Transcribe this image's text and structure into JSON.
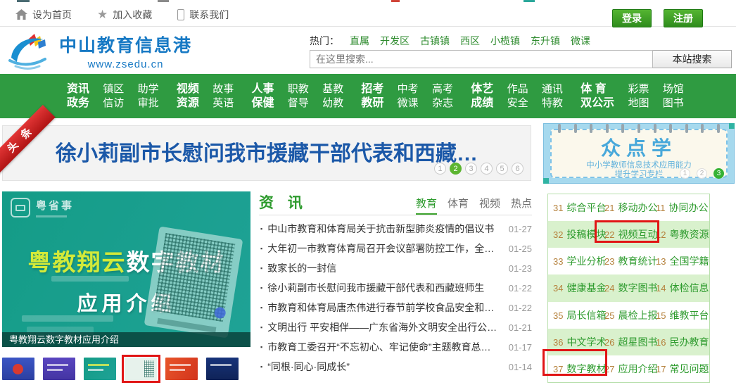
{
  "topbar": {
    "links": [
      {
        "icon": "home-icon",
        "label": "设为首页"
      },
      {
        "icon": "star-icon",
        "label": "加入收藏"
      },
      {
        "icon": "phone-icon",
        "label": "联系我们"
      }
    ],
    "login_label": "登录",
    "register_label": "注册"
  },
  "header": {
    "site_name": "中山教育信息港",
    "site_url": "www.zsedu.cn",
    "hot_label": "热门：",
    "hot_links": [
      "直属",
      "开发区",
      "古镇镇",
      "西区",
      "小榄镇",
      "东升镇",
      "微课"
    ],
    "search": {
      "placeholder": "在这里搜索...",
      "button_label": "本站搜索"
    }
  },
  "nav": {
    "columns": [
      {
        "top": "资讯",
        "bottom": "政务"
      },
      {
        "top": "镇区",
        "bottom": "信访"
      },
      {
        "top": "助学",
        "bottom": "审批"
      },
      {
        "top": "视频",
        "bottom": "资源"
      },
      {
        "top": "故事",
        "bottom": "英语"
      },
      {
        "top": "人事",
        "bottom": "保健"
      },
      {
        "top": "职教",
        "bottom": "督导"
      },
      {
        "top": "基教",
        "bottom": "幼教"
      },
      {
        "top": "招考",
        "bottom": "教研"
      },
      {
        "top": "中考",
        "bottom": "微课"
      },
      {
        "top": "高考",
        "bottom": "杂志"
      },
      {
        "top": "体艺",
        "bottom": "成绩"
      },
      {
        "top": "作品",
        "bottom": "安全"
      },
      {
        "top": "通讯",
        "bottom": "特教"
      },
      {
        "top": "体 育",
        "bottom": "双公示"
      },
      {
        "top": "彩票",
        "bottom": "地图"
      },
      {
        "top": "场馆",
        "bottom": "图书"
      }
    ]
  },
  "headline": {
    "ribbon": "头条",
    "title": "徐小莉副市长慰问我市援藏干部代表和西藏…",
    "pager": [
      "1",
      "2",
      "3",
      "4",
      "5",
      "6"
    ],
    "active_page": "2"
  },
  "promo": {
    "title": "众点学",
    "subtitle_line1": "中小学教师信息技术应用能力",
    "subtitle_line2": "提升学习专栏",
    "pager": [
      "1",
      "2",
      "3"
    ],
    "active_page": "3"
  },
  "carousel": {
    "badge": "粤省事",
    "slide_title_part1": "粤教翔云",
    "slide_title_part2": "数字教材",
    "slide_title_line2": "应用介绍",
    "caption": "粤教翔云数字教材应用介绍",
    "thumbnail_count": 6,
    "active_thumbnail": 4
  },
  "news": {
    "section_title": "资 讯",
    "tabs": [
      {
        "label": "教育",
        "active": true
      },
      {
        "label": "体育",
        "active": false
      },
      {
        "label": "视频",
        "active": false
      },
      {
        "label": "热点",
        "active": false
      }
    ],
    "items": [
      {
        "title": "中山市教育和体育局关于抗击新型肺炎疫情的倡议书",
        "date": "01-27"
      },
      {
        "title": "大年初一市教育体育局召开会议部署防控工作，全力…",
        "date": "01-25"
      },
      {
        "title": "致家长的一封信",
        "date": "01-23"
      },
      {
        "title": "徐小莉副市长慰问我市援藏干部代表和西藏班师生",
        "date": "01-22"
      },
      {
        "title": "市教育和体育局唐杰伟进行春节前学校食品安全和传…",
        "date": "01-22"
      },
      {
        "title": "文明出行 平安相伴——广东省海外文明安全出行公…",
        "date": "01-21"
      },
      {
        "title": "市教育工委召开“不忘初心、牢记使命”主题教育总…",
        "date": "01-17"
      },
      {
        "title": "“同根·同心·同成长”",
        "date": "01-14"
      }
    ]
  },
  "quicklinks": {
    "rows": [
      [
        {
          "num": "31",
          "label": "综合平台"
        },
        {
          "num": "21",
          "label": "移动办公"
        },
        {
          "num": "11",
          "label": "协同办公"
        }
      ],
      [
        {
          "num": "32",
          "label": "投稿模块"
        },
        {
          "num": "22",
          "label": "视频互动"
        },
        {
          "num": "12",
          "label": "粤教资源"
        }
      ],
      [
        {
          "num": "33",
          "label": "学业分析"
        },
        {
          "num": "23",
          "label": "教育统计"
        },
        {
          "num": "13",
          "label": "全国学籍"
        }
      ],
      [
        {
          "num": "34",
          "label": "健康基金"
        },
        {
          "num": "24",
          "label": "数字图书"
        },
        {
          "num": "14",
          "label": "体检信息"
        }
      ],
      [
        {
          "num": "35",
          "label": "局长信箱"
        },
        {
          "num": "25",
          "label": "晨检上报"
        },
        {
          "num": "15",
          "label": "维教平台"
        }
      ],
      [
        {
          "num": "36",
          "label": "中文学术"
        },
        {
          "num": "26",
          "label": "超星图书"
        },
        {
          "num": "16",
          "label": "民办教育"
        }
      ],
      [
        {
          "num": "37",
          "label": "数字教材"
        },
        {
          "num": "27",
          "label": "应用介绍"
        },
        {
          "num": "17",
          "label": "常见问题"
        }
      ]
    ]
  },
  "annotations": {
    "highlight_color": "#e11515",
    "targets": [
      "quicklink-22-视频互动",
      "quicklink-37-数字教材",
      "carousel-thumbnail-4"
    ]
  },
  "colors": {
    "nav_green": "#2f9b41",
    "link_green": "#2e8b2e",
    "headline_blue": "#1b58a8",
    "ribbon_red": "#c81e1e",
    "promo_blue": "#48a8da",
    "pager_active_green": "#5cb531",
    "grid_row_green": "#d9f1cd",
    "carousel_teal": "#18a08e",
    "logo_blue": "#1779c4"
  }
}
